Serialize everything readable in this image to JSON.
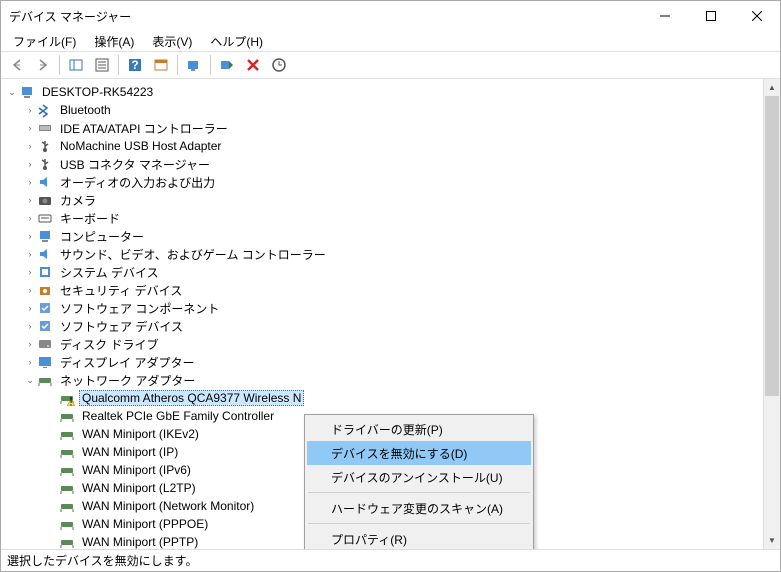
{
  "title": "デバイス マネージャー",
  "menu": {
    "file": "ファイル(F)",
    "action": "操作(A)",
    "view": "表示(V)",
    "help": "ヘルプ(H)"
  },
  "tree": {
    "root": "DESKTOP-RK54223",
    "categories": [
      {
        "label": "Bluetooth",
        "icon": "bluetooth"
      },
      {
        "label": "IDE ATA/ATAPI コントローラー",
        "icon": "ide"
      },
      {
        "label": "NoMachine USB Host Adapter",
        "icon": "usb"
      },
      {
        "label": "USB コネクタ マネージャー",
        "icon": "usb"
      },
      {
        "label": "オーディオの入力および出力",
        "icon": "audio"
      },
      {
        "label": "カメラ",
        "icon": "camera"
      },
      {
        "label": "キーボード",
        "icon": "keyboard"
      },
      {
        "label": "コンピューター",
        "icon": "computer"
      },
      {
        "label": "サウンド、ビデオ、およびゲーム コントローラー",
        "icon": "audio"
      },
      {
        "label": "システム デバイス",
        "icon": "system"
      },
      {
        "label": "セキュリティ デバイス",
        "icon": "security"
      },
      {
        "label": "ソフトウェア コンポーネント",
        "icon": "software"
      },
      {
        "label": "ソフトウェア デバイス",
        "icon": "software"
      },
      {
        "label": "ディスク ドライブ",
        "icon": "disk"
      },
      {
        "label": "ディスプレイ アダプター",
        "icon": "display"
      },
      {
        "label": "ネットワーク アダプター",
        "icon": "network",
        "expanded": true,
        "children": [
          {
            "label": "Qualcomm Atheros QCA9377 Wireless N",
            "selected": true,
            "warning": true
          },
          {
            "label": "Realtek PCIe GbE Family Controller"
          },
          {
            "label": "WAN Miniport (IKEv2)"
          },
          {
            "label": "WAN Miniport (IP)"
          },
          {
            "label": "WAN Miniport (IPv6)"
          },
          {
            "label": "WAN Miniport (L2TP)"
          },
          {
            "label": "WAN Miniport (Network Monitor)"
          },
          {
            "label": "WAN Miniport (PPPOE)"
          },
          {
            "label": "WAN Miniport (PPTP)"
          }
        ]
      }
    ]
  },
  "context_menu": {
    "update_driver": "ドライバーの更新(P)",
    "disable_device": "デバイスを無効にする(D)",
    "uninstall_device": "デバイスのアンインストール(U)",
    "scan_hardware": "ハードウェア変更のスキャン(A)",
    "properties": "プロパティ(R)"
  },
  "statusbar": "選択したデバイスを無効にします。"
}
